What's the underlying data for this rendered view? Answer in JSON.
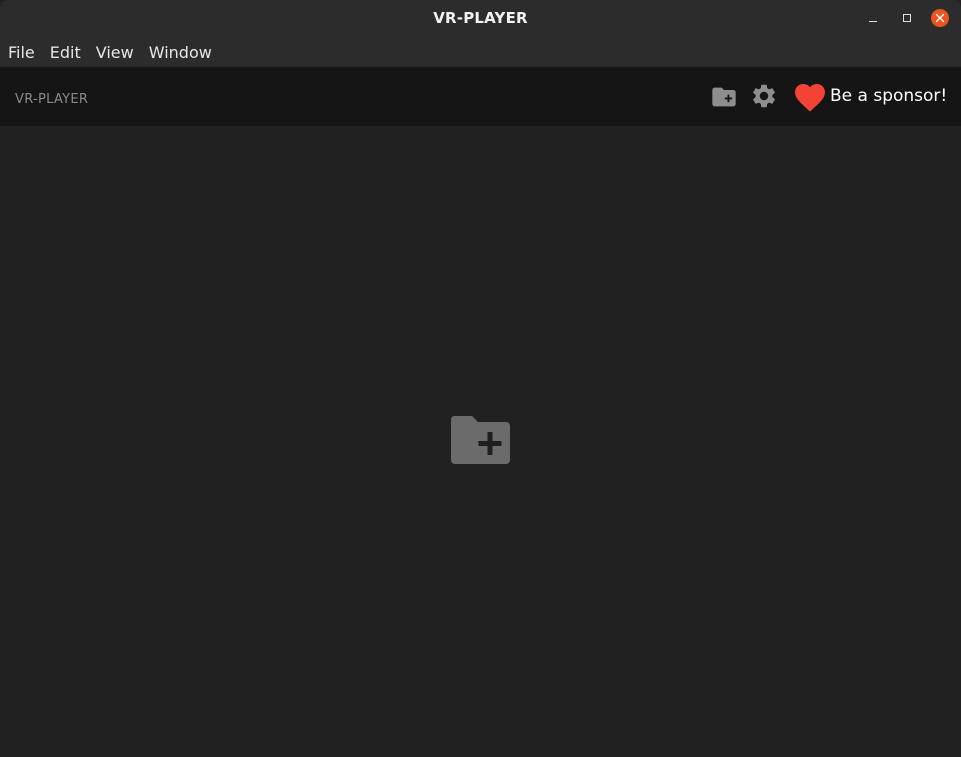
{
  "window": {
    "title": "VR-PLAYER",
    "controls": {
      "minimize": "minimize-icon",
      "maximize": "maximize-icon",
      "close": "close-icon"
    },
    "close_color": "#e95420"
  },
  "menubar": {
    "items": [
      {
        "label": "File"
      },
      {
        "label": "Edit"
      },
      {
        "label": "View"
      },
      {
        "label": "Window"
      }
    ]
  },
  "toolbar": {
    "app_label": "VR-PLAYER",
    "icons": [
      "folder-add-icon",
      "gear-icon",
      "heart-icon"
    ],
    "sponsor_label": "Be a sponsor!",
    "heart_color": "#f44336"
  },
  "main": {
    "center_icon": "folder-add-icon"
  }
}
